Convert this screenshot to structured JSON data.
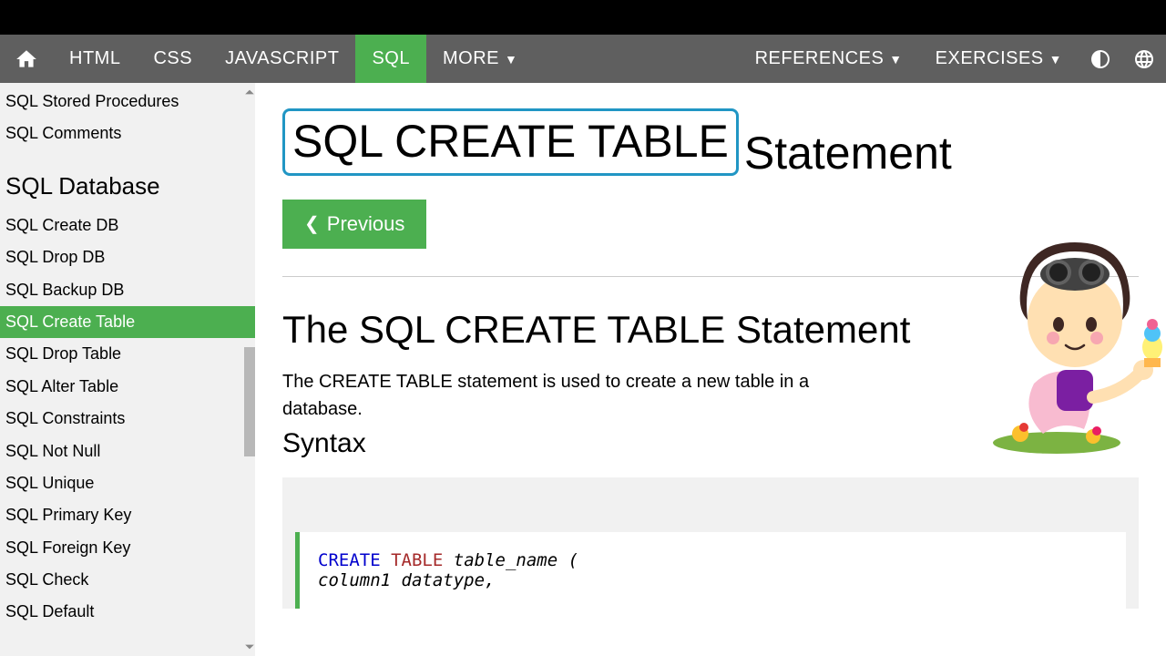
{
  "topnav": {
    "items": [
      "HTML",
      "CSS",
      "JAVASCRIPT",
      "SQL",
      "MORE"
    ],
    "right": [
      "REFERENCES",
      "EXERCISES"
    ],
    "active": "SQL"
  },
  "sidebar": {
    "top_links": [
      "SQL Stored Procedures",
      "SQL Comments"
    ],
    "heading": "SQL Database",
    "links": [
      "SQL Create DB",
      "SQL Drop DB",
      "SQL Backup DB",
      "SQL Create Table",
      "SQL Drop Table",
      "SQL Alter Table",
      "SQL Constraints",
      "SQL Not Null",
      "SQL Unique",
      "SQL Primary Key",
      "SQL Foreign Key",
      "SQL Check",
      "SQL Default"
    ],
    "active": "SQL Create Table"
  },
  "main": {
    "title_boxed": "SQL CREATE TABLE",
    "title_rest": "Statement",
    "prev_label": "Previous",
    "h2": "The SQL CREATE TABLE Statement",
    "desc": "The CREATE TABLE statement is used to create a new table in a database.",
    "h3": "Syntax",
    "code": {
      "kw1": "CREATE",
      "kw2": "TABLE",
      "rest1": "table_name (",
      "indent": "    column1 datatype,"
    }
  }
}
